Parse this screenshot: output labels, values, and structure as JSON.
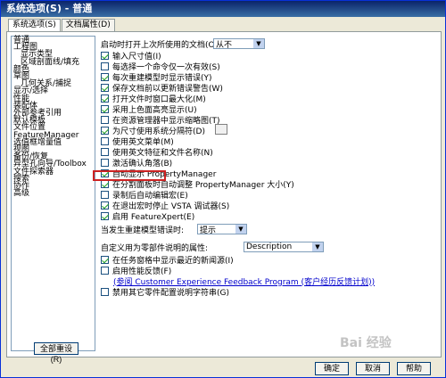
{
  "window": {
    "title": "系统选项(S) - 普通"
  },
  "tabs": [
    {
      "label": "系统选项(S)"
    },
    {
      "label": "文档属性(D)"
    }
  ],
  "tree": [
    {
      "label": "普通"
    },
    {
      "label": "工程图"
    },
    {
      "label": "显示类型"
    },
    {
      "label": "区域剖面线/填充"
    },
    {
      "label": "颜色"
    },
    {
      "label": "草图"
    },
    {
      "label": "几何关系/捕捉"
    },
    {
      "label": "显示/选择"
    },
    {
      "label": "性能"
    },
    {
      "label": "装配体"
    },
    {
      "label": "外部参考引用"
    },
    {
      "label": "默认模板"
    },
    {
      "label": "文件位置"
    },
    {
      "label": "FeatureManager"
    },
    {
      "label": "选值框增量值"
    },
    {
      "label": "视图"
    },
    {
      "label": "备份/恢复"
    },
    {
      "label": "异型孔向导/Toolbox"
    },
    {
      "label": "文件探索器"
    },
    {
      "label": "搜索"
    },
    {
      "label": "协作"
    },
    {
      "label": "高级"
    }
  ],
  "reset_button": "全部重设(R)",
  "main": {
    "open_docs_label": "启动时打开上次所使用的文档(O):",
    "open_docs_value": "从不",
    "options": [
      {
        "label": "输入尺寸值(I)"
      },
      {
        "label": "每选择一个命令仅一次有效(S)"
      },
      {
        "label": "每次重建模型时显示错误(Y)"
      },
      {
        "label": "保存文档前以更新错误警告(W)"
      },
      {
        "label": "打开文件时窗口最大化(M)"
      },
      {
        "label": "采用上色面高亮显示(U)"
      },
      {
        "label": "在资源管理器中显示缩略图(T)"
      },
      {
        "label": "为尺寸使用系统分隔符(D)"
      },
      {
        "label": "使用英文菜单(M)"
      },
      {
        "label": "使用英文特征和文件名称(N)"
      },
      {
        "label": "激活确认角落(B)"
      },
      {
        "label": "自动显示 PropertyManager"
      },
      {
        "label": "在分割面板时自动调整 PropertyManager 大小(Y)"
      },
      {
        "label": "录制后自动编辑宏(E)"
      },
      {
        "label": "在退出宏时停止 VSTA 调试器(S)"
      },
      {
        "label": "启用 FeatureXpert(E)"
      }
    ],
    "rebuild_label": "当发生重建模型错误时:",
    "rebuild_value": "提示",
    "custom_prop_label": "自定义用为零部件说明的属性:",
    "custom_prop_value": "Description",
    "options2": [
      {
        "label": "在任务窗格中显示最近的新闻源(I)"
      },
      {
        "label": "启用性能反馈(F)"
      }
    ],
    "experience_link": "(参阅 Customer Experience Feedback Program (客户经历反馈计划))",
    "last_option": "禁用其它零件配置说明字符串(G)"
  },
  "footer": {
    "ok": "确定",
    "cancel": "取消",
    "help": "帮助"
  },
  "watermark": "Bai 经验"
}
